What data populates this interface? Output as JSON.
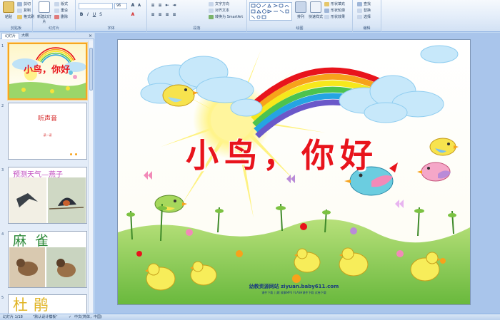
{
  "ribbon": {
    "groups": [
      {
        "label": "剪贴板",
        "items": [
          "粘贴",
          "剪切",
          "复制",
          "格式刷"
        ]
      },
      {
        "label": "幻灯片",
        "items": [
          "新建幻灯片",
          "版式",
          "重设",
          "删除"
        ]
      },
      {
        "label": "字体",
        "font_size": "96"
      },
      {
        "label": "段落",
        "items": [
          "文字方向",
          "对齐文本",
          "转换为 SmartArt"
        ]
      },
      {
        "label": "绘图",
        "items": [
          "排列",
          "快速样式",
          "形状填充",
          "形状轮廓",
          "形状效果"
        ]
      },
      {
        "label": "编辑",
        "items": [
          "查找",
          "替换",
          "选择"
        ]
      }
    ]
  },
  "panel": {
    "tabs": [
      "幻灯片",
      "大纲"
    ],
    "close": "×",
    "slides": [
      {
        "num": "1",
        "title": "小鸟，你好"
      },
      {
        "num": "2",
        "title": "听声音",
        "sub": "读一读"
      },
      {
        "num": "3",
        "title": "预测天气—燕子"
      },
      {
        "num": "4",
        "title": "麻雀"
      },
      {
        "num": "5",
        "title": "杜鹃"
      }
    ]
  },
  "slide": {
    "title": "小鸟，你好",
    "watermark_line1": "幼教资源网站 ziyuan.baby611.com",
    "watermark_line2": "课件下载  儿歌  故事MP3  FLASH课件下载  试卷下载"
  },
  "status": {
    "slide_info": "幻灯片 1/18",
    "theme": "\"默认设计模板\"",
    "language": "中文(简体，中国)"
  },
  "colors": {
    "accent": "#2b579a",
    "title_red": "#e8141c",
    "sky": "#8ecff5",
    "grass": "#7cc242"
  }
}
